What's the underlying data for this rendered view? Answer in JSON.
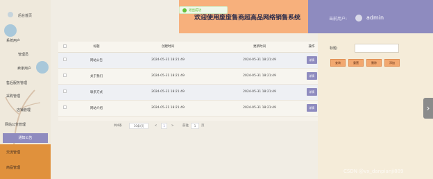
{
  "sidebar": {
    "home": "后台首页",
    "groups": [
      {
        "label": "系统用户"
      },
      {
        "label": "管理员"
      },
      {
        "label": "卖家用户"
      },
      {
        "label": "售后服务管理"
      },
      {
        "label": "采购管理"
      },
      {
        "label": "店铺管理"
      },
      {
        "label": "网站公告管理"
      }
    ],
    "active": "通知公告",
    "bottom": [
      "交流管理",
      "商品管理"
    ]
  },
  "header": {
    "title": "欢迎使用废废售商超高品网络销售系统",
    "user_label": "当前用户:",
    "user_name": "admin"
  },
  "toast": {
    "text": "退出成功"
  },
  "table": {
    "columns": [
      "标题",
      "创建时间",
      "更新时间",
      "操作"
    ],
    "rows": [
      {
        "title": "网站公告",
        "created": "2024-05-31 18:21:49",
        "updated": "2024-05-31 18:21:49",
        "action": "详情"
      },
      {
        "title": "关于我们",
        "created": "2024-05-31 18:21:49",
        "updated": "2024-05-31 18:21:49",
        "action": "详情"
      },
      {
        "title": "联系方式",
        "created": "2024-05-31 18:21:49",
        "updated": "2024-05-31 18:21:49",
        "action": "详情"
      },
      {
        "title": "网站介绍",
        "created": "2024-05-31 18:21:49",
        "updated": "2024-05-31 18:21:49",
        "action": "详情"
      }
    ]
  },
  "pager": {
    "total": "共4条",
    "per_page": "10条/页",
    "prev": "<",
    "page": "1",
    "next": ">",
    "goto": "前往",
    "goto_page": "1",
    "unit": "页"
  },
  "search": {
    "label": "标题:",
    "placeholder": "",
    "buttons": [
      "查询",
      "重置",
      "删除",
      "添加"
    ]
  },
  "watermark": "CSDN @vx_danpianji889"
}
